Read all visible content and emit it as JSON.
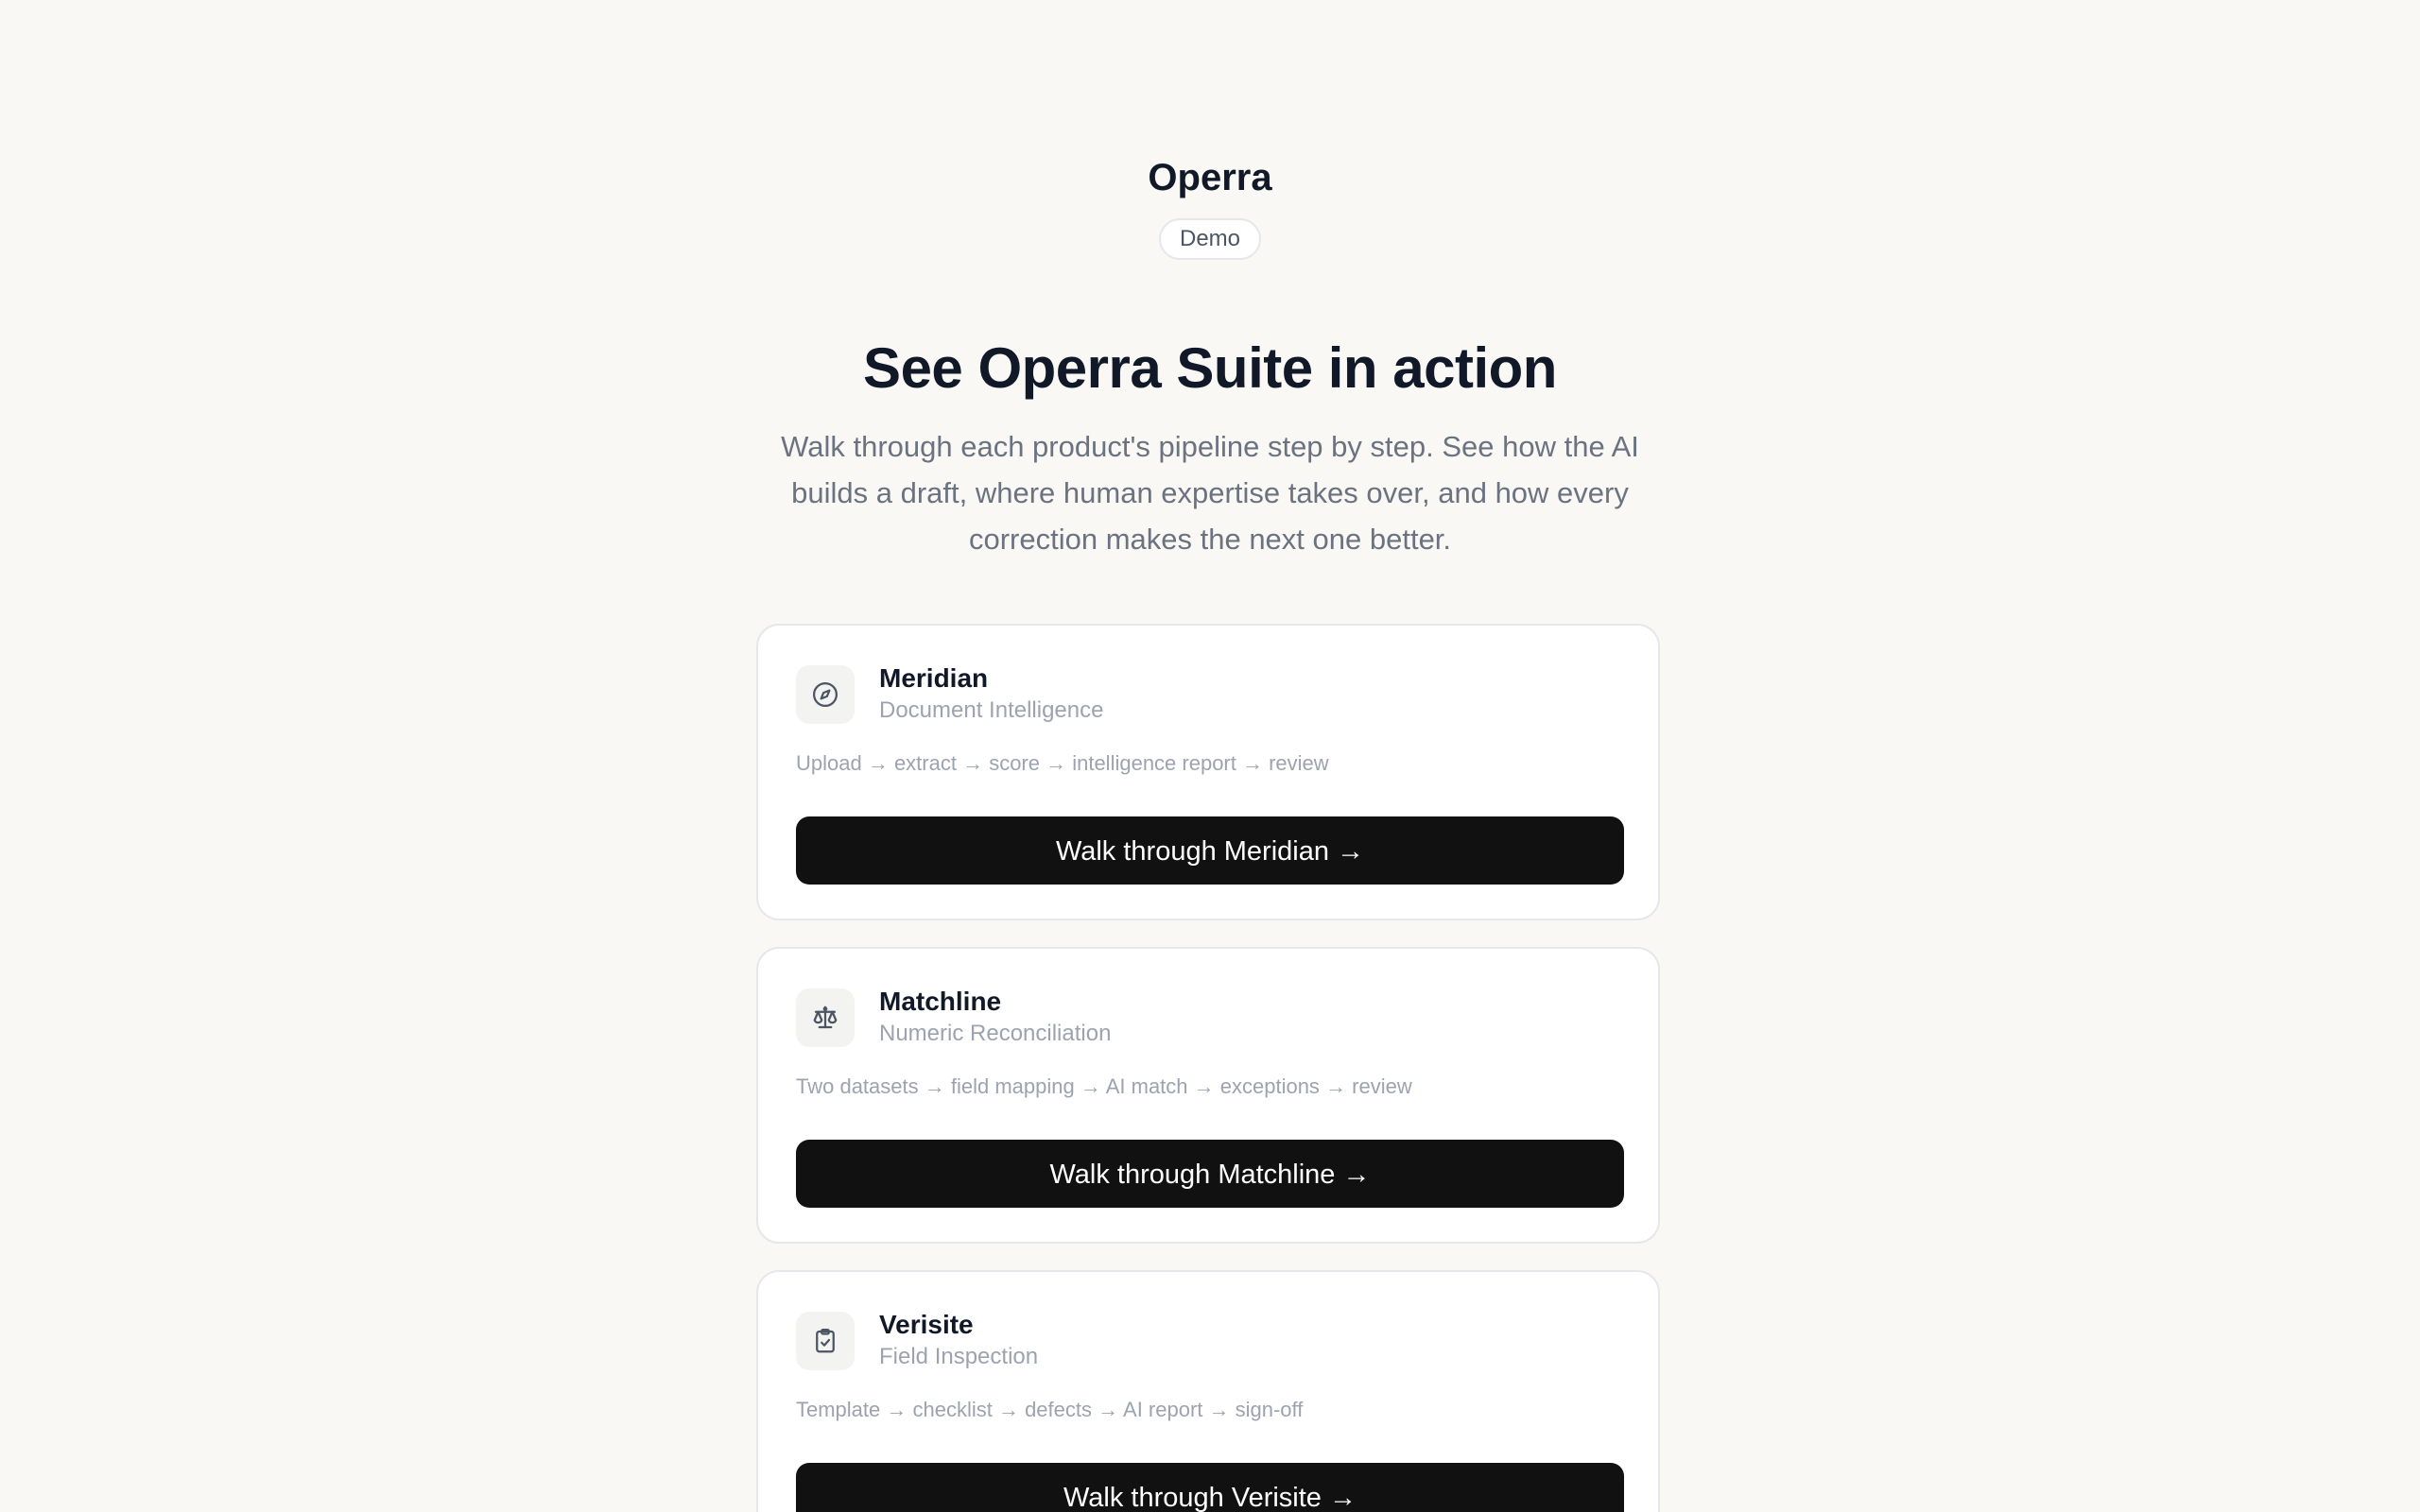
{
  "brand": {
    "name": "Operra",
    "badge": "Demo"
  },
  "hero": {
    "title": "See Operra Suite in action",
    "subtitle": "Walk through each product's pipeline step by step. See how the AI builds a draft, where human expertise takes over, and how every correction makes the next one better."
  },
  "products": [
    {
      "name": "Meridian",
      "category": "Document Intelligence",
      "pipeline": "Upload → extract → score → intelligence report → review",
      "button_label": "Walk through Meridian →",
      "icon": "compass-icon"
    },
    {
      "name": "Matchline",
      "category": "Numeric Reconciliation",
      "pipeline": "Two datasets → field mapping → AI match → exceptions → review",
      "button_label": "Walk through Matchline →",
      "icon": "scale-icon"
    },
    {
      "name": "Verisite",
      "category": "Field Inspection",
      "pipeline": "Template → checklist → defects → AI report → sign-off",
      "button_label": "Walk through Verisite →",
      "icon": "clipboard-check-icon"
    }
  ],
  "colors": {
    "background": "#f9f8f5",
    "button": "#111111",
    "muted_text": "#9ca3af"
  }
}
